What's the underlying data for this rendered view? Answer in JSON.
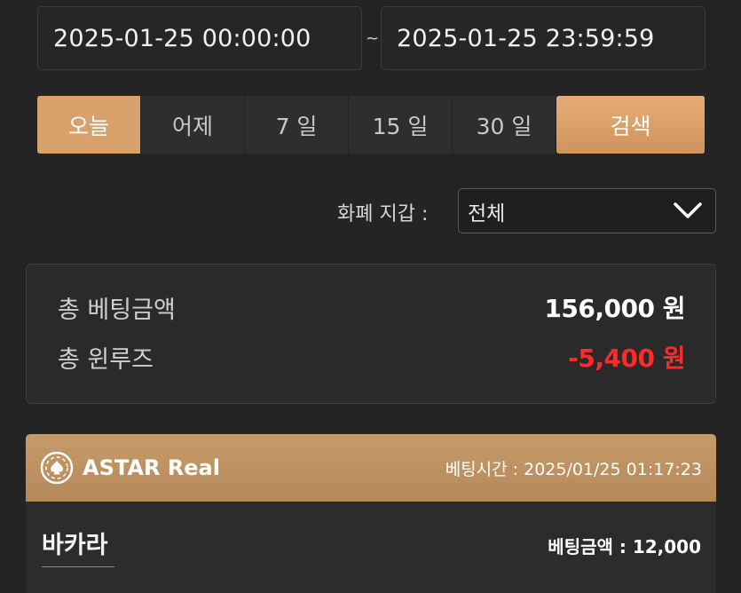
{
  "date_range": {
    "start": "2025-01-25 00:00:00",
    "separator": "~",
    "end": "2025-01-25 23:59:59"
  },
  "quick_filters": [
    "오늘",
    "어제",
    "7 일",
    "15 일",
    "30 일"
  ],
  "search_label": "검색",
  "currency_filter": {
    "label": "화폐 지갑 :",
    "selected": "전체"
  },
  "summary": {
    "total_bet_label": "총 베팅금액",
    "total_bet_value": "156,000 원",
    "total_win_loss_label": "총 윈루즈",
    "total_win_loss_value": "-5,400 원"
  },
  "bet_card": {
    "provider": "ASTAR Real",
    "bet_time": "베팅시간 : 2025/01/25 01:17:23",
    "game": "바카라",
    "bet_amount": "베팅금액 : 12,000",
    "icon": "poker-chip-icon"
  },
  "colors": {
    "accent": "#d8a06b",
    "negative": "#ff2a2a",
    "background": "#242424"
  }
}
